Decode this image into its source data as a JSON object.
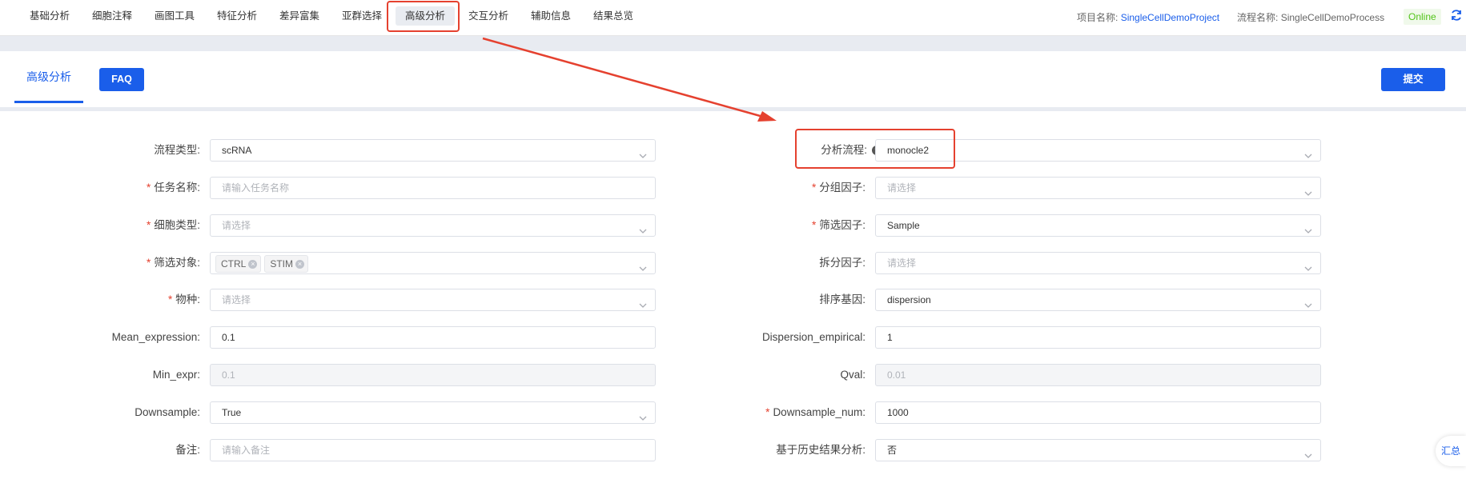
{
  "nav": {
    "items": [
      "基础分析",
      "细胞注释",
      "画图工具",
      "特征分析",
      "差异富集",
      "亚群选择",
      "高级分析",
      "交互分析",
      "辅助信息",
      "结果总览"
    ],
    "active_index": 6,
    "project_label": "项目名称:",
    "project_value": "SingleCellDemoProject",
    "process_label": "流程名称:",
    "process_value": "SingleCellDemoProcess",
    "status": "Online",
    "refresh_icon": "refresh-icon"
  },
  "tabs": {
    "active_label": "高级分析",
    "faq_label": "FAQ",
    "submit_label": "提交"
  },
  "form": {
    "left": [
      {
        "label": "流程类型:",
        "required": false,
        "value": "scRNA",
        "type": "select"
      },
      {
        "label": "任务名称:",
        "required": true,
        "placeholder": "请输入任务名称",
        "type": "input"
      },
      {
        "label": "细胞类型:",
        "required": true,
        "placeholder": "请选择",
        "type": "select"
      },
      {
        "label": "筛选对象:",
        "required": true,
        "tags": [
          "CTRL",
          "STIM"
        ],
        "type": "multiselect"
      },
      {
        "label": "物种:",
        "required": true,
        "placeholder": "请选择",
        "type": "select"
      },
      {
        "label": "Mean_expression:",
        "required": false,
        "value": "0.1",
        "type": "input"
      },
      {
        "label": "Min_expr:",
        "required": false,
        "value": "0.1",
        "type": "disabled"
      },
      {
        "label": "Downsample:",
        "required": false,
        "value": "True",
        "type": "select"
      },
      {
        "label": "备注:",
        "required": false,
        "placeholder": "请输入备注",
        "type": "input"
      }
    ],
    "right": [
      {
        "label": "分析流程:",
        "required": false,
        "help": true,
        "value": "monocle2",
        "type": "select"
      },
      {
        "label": "分组因子:",
        "required": true,
        "placeholder": "请选择",
        "type": "select"
      },
      {
        "label": "筛选因子:",
        "required": true,
        "value": "Sample",
        "type": "select"
      },
      {
        "label": "拆分因子:",
        "required": false,
        "placeholder": "请选择",
        "type": "select"
      },
      {
        "label": "排序基因:",
        "required": false,
        "value": "dispersion",
        "type": "select"
      },
      {
        "label": "Dispersion_empirical:",
        "required": false,
        "value": "1",
        "type": "input"
      },
      {
        "label": "Qval:",
        "required": false,
        "value": "0.01",
        "type": "disabled"
      },
      {
        "label": "Downsample_num:",
        "required": true,
        "value": "1000",
        "type": "input"
      },
      {
        "label": "基于历史结果分析:",
        "required": false,
        "value": "否",
        "type": "select"
      }
    ]
  },
  "side_button": "汇总",
  "colors": {
    "primary": "#1a5eea",
    "highlight": "#e5412f",
    "online": "#52c41a"
  }
}
